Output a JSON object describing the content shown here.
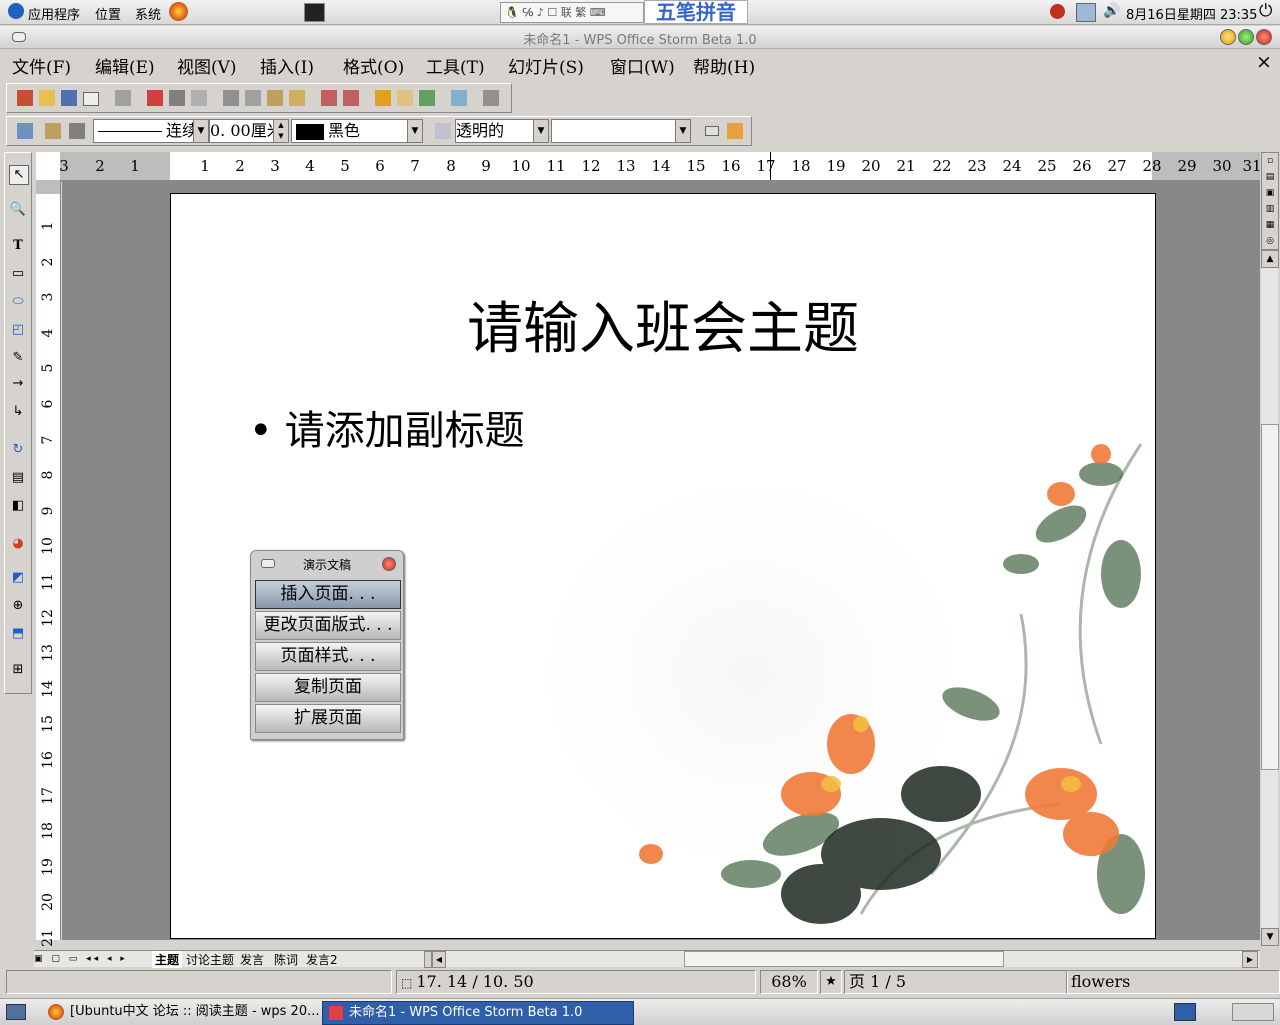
{
  "top_panel": {
    "menus": [
      "应用程序",
      "位置",
      "系统"
    ],
    "ime_label": "五笔拼音",
    "clock": "8月16日星期四 23:35"
  },
  "window": {
    "title": "未命名1 - WPS Office Storm Beta 1.0",
    "close_label": "×"
  },
  "menubar": {
    "items": [
      "文件(F)",
      "编辑(E)",
      "视图(V)",
      "插入(I)",
      "格式(O)",
      "工具(T)",
      "幻灯片(S)",
      "窗口(W)",
      "帮助(H)"
    ]
  },
  "format_toolbar": {
    "line_style": "连续",
    "line_width": "0. 00厘米",
    "line_color": "黑色",
    "line_color_swatch": "#000000",
    "fill": "透明的",
    "fill_value": ""
  },
  "rulers": {
    "h_ticks": [
      "3",
      "2",
      "1",
      "1",
      "2",
      "3",
      "4",
      "5",
      "6",
      "7",
      "8",
      "9",
      "10",
      "11",
      "12",
      "13",
      "14",
      "15",
      "16",
      "17",
      "18",
      "19",
      "20",
      "21",
      "22",
      "23",
      "24",
      "25",
      "26",
      "27",
      "28",
      "29",
      "30",
      "31"
    ],
    "v_ticks": [
      "1",
      "2",
      "3",
      "4",
      "5",
      "6",
      "7",
      "8",
      "9",
      "10",
      "11",
      "12",
      "13",
      "14",
      "15",
      "16",
      "17",
      "18",
      "19",
      "20",
      "21"
    ]
  },
  "slide": {
    "title": "请输入班会主题",
    "subtitle": "请添加副标题",
    "bullet": "•"
  },
  "float_panel": {
    "title": "演示文稿",
    "buttons": [
      "插入页面. . .",
      "更改页面版式. . .",
      "页面样式. . .",
      "复制页面",
      "扩展页面"
    ]
  },
  "slide_tabs": [
    "主题",
    "讨论主题",
    "发言",
    "陈词",
    "发言2"
  ],
  "statusbar": {
    "position": "17. 14 / 10. 50",
    "zoom": "68%",
    "star": "★",
    "page": "页  1 / 5",
    "layout": "flowers"
  },
  "taskbar": {
    "tasks": [
      "[Ubuntu中文 论坛 :: 阅读主题 - wps 20...",
      "未命名1 - WPS Office Storm Beta 1.0"
    ]
  },
  "colors": {
    "accent": "#2f5fa8",
    "flower_orange": "#f08040",
    "leaf_green": "#4a6a4a"
  }
}
